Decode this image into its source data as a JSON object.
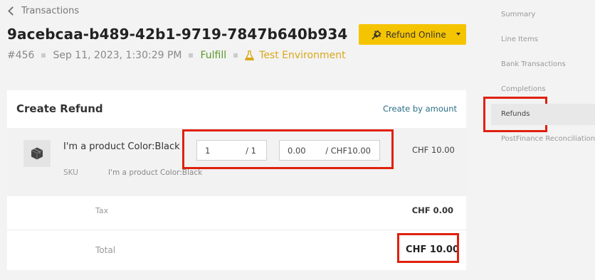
{
  "back": {
    "label": "Transactions"
  },
  "transaction": {
    "id": "9acebcaa-b489-42b1-9719-7847b640b934",
    "number": "#456",
    "date": "Sep 11, 2023, 1:30:29 PM",
    "status": "Fulfill",
    "environment": "Test Environment"
  },
  "actions": {
    "refund_label": "Refund Online"
  },
  "refund": {
    "title": "Create Refund",
    "create_by_amount": "Create by amount",
    "item": {
      "name": "I'm a product Color:Black",
      "sku_label": "SKU",
      "sku_value": "I'm a product Color:Black",
      "quantity_value": "1",
      "quantity_max": "/ 1",
      "amount_value": "0.00",
      "amount_max": "/ CHF10.00",
      "price": "CHF 10.00"
    },
    "tax_label": "Tax",
    "tax_value": "CHF 0.00",
    "total_label": "Total",
    "total_value": "CHF 10.00"
  },
  "sidebar": {
    "items": [
      {
        "label": "Summary"
      },
      {
        "label": "Line Items"
      },
      {
        "label": "Bank Transactions"
      },
      {
        "label": "Completions"
      },
      {
        "label": "Refunds"
      },
      {
        "label": "PostFinance Reconciliations"
      }
    ]
  },
  "icons": {
    "back": "chevron-left-icon",
    "environment": "flask-icon",
    "refund": "plug-icon",
    "product": "box-icon"
  },
  "colors": {
    "accent": "#f5c400",
    "status": "#5a9a2a",
    "environment": "#d9a81a",
    "link": "#2a6e86",
    "highlight": "#e0200f"
  }
}
